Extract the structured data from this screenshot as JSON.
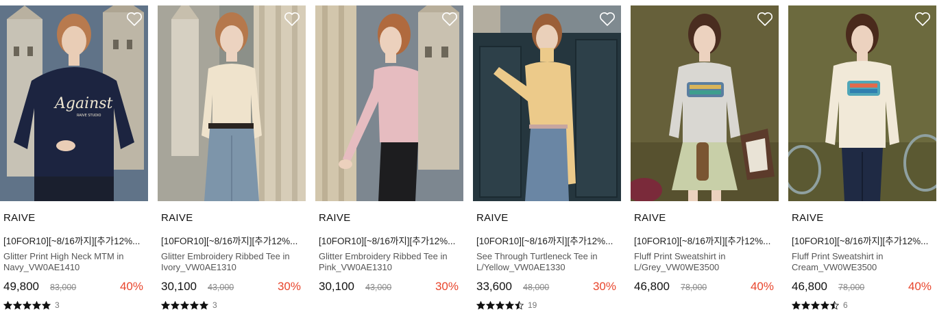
{
  "products": [
    {
      "brand": "RAIVE",
      "promo": "[10FOR10][~8/16까지][추가12%...",
      "name": "Glitter Print High Neck MTM in Navy_VW0AE1410",
      "price": "49,800",
      "original_price": "83,000",
      "discount": "40%",
      "rating": 5,
      "review_count": "3",
      "colors": {
        "bg": "#5b6f86",
        "top": "#1c2440",
        "bottom": "#1a1f2e",
        "hair": "#b87a4e",
        "skin": "#e9cdb6"
      },
      "print_text": "Against"
    },
    {
      "brand": "RAIVE",
      "promo": "[10FOR10][~8/16까지][추가12%...",
      "name": "Glitter Embroidery Ribbed Tee in Ivory_VW0AE1310",
      "price": "30,100",
      "original_price": "43,000",
      "discount": "30%",
      "rating": 5,
      "review_count": "3",
      "colors": {
        "bg": "#8a8f8c",
        "top": "#efe3cc",
        "bottom": "#7d95aa",
        "hair": "#b5784c",
        "skin": "#ecd3c0"
      }
    },
    {
      "brand": "RAIVE",
      "promo": "[10FOR10][~8/16까지][추가12%...",
      "name": "Glitter Embroidery Ribbed Tee in Pink_VW0AE1310",
      "price": "30,100",
      "original_price": "43,000",
      "discount": "30%",
      "colors": {
        "bg": "#7d8790",
        "top": "#e6bcc0",
        "bottom": "#1d1d1f",
        "hair": "#b06a3e",
        "skin": "#ecd1bd"
      }
    },
    {
      "brand": "RAIVE",
      "promo": "[10FOR10][~8/16까지][추가12%...",
      "name": "See Through Turtleneck Tee in L/Yellow_VW0AE1330",
      "price": "33,600",
      "original_price": "48,000",
      "discount": "30%",
      "rating": 4.5,
      "review_count": "19",
      "colors": {
        "bg": "#25363e",
        "top": "#ecca8a",
        "bottom": "#6a86a4",
        "hair": "#9b5f38",
        "skin": "#ead0ba"
      }
    },
    {
      "brand": "RAIVE",
      "promo": "[10FOR10][~8/16까지][추가12%...",
      "name": "Fluff Print Sweatshirt in L/Grey_VW0WE3500",
      "price": "46,800",
      "original_price": "78,000",
      "discount": "40%",
      "colors": {
        "bg": "#66603a",
        "top": "#d9d7d2",
        "bottom": "#c8cfa8",
        "hair": "#4a2d20",
        "skin": "#ecd2bf"
      }
    },
    {
      "brand": "RAIVE",
      "promo": "[10FOR10][~8/16까지][추가12%...",
      "name": "Fluff Print Sweatshirt in Cream_VW0WE3500",
      "price": "46,800",
      "original_price": "78,000",
      "discount": "40%",
      "rating": 4.5,
      "review_count": "6",
      "colors": {
        "bg": "#6c6a3e",
        "top": "#f1e9d8",
        "bottom": "#1f2a44",
        "hair": "#4a2a1c",
        "skin": "#ecd2bf"
      }
    }
  ],
  "theme": {
    "discount_color": "#e8452c",
    "star_color": "#111111"
  }
}
